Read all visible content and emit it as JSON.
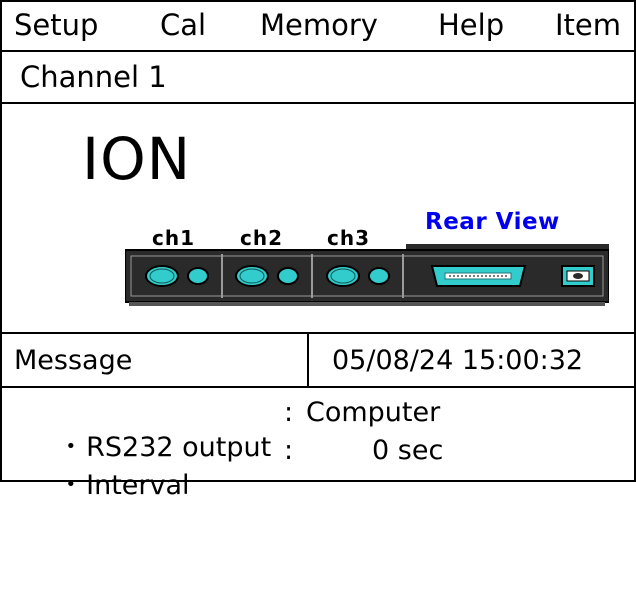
{
  "menu": {
    "items": [
      "Setup",
      "Cal",
      "Memory",
      "Help",
      "Item"
    ]
  },
  "channel": {
    "label": "Channel 1"
  },
  "main": {
    "title": "ION",
    "rear_view_label": "Rear View",
    "channel_labels": [
      "ch1",
      "ch2",
      "ch3"
    ]
  },
  "status": {
    "message_label": "Message",
    "datetime": "05/08/24 15:00:32"
  },
  "info": {
    "rows": [
      {
        "bullet": "•",
        "label": "RS232 output",
        "separator": ":",
        "value": "Computer"
      },
      {
        "bullet": "•",
        "label": "Interval",
        "separator": ":",
        "value": "0 sec"
      }
    ]
  },
  "colors": {
    "link": "#0000ee",
    "port_fill": "#33cccc",
    "panel_body": "#2a2a2a"
  }
}
